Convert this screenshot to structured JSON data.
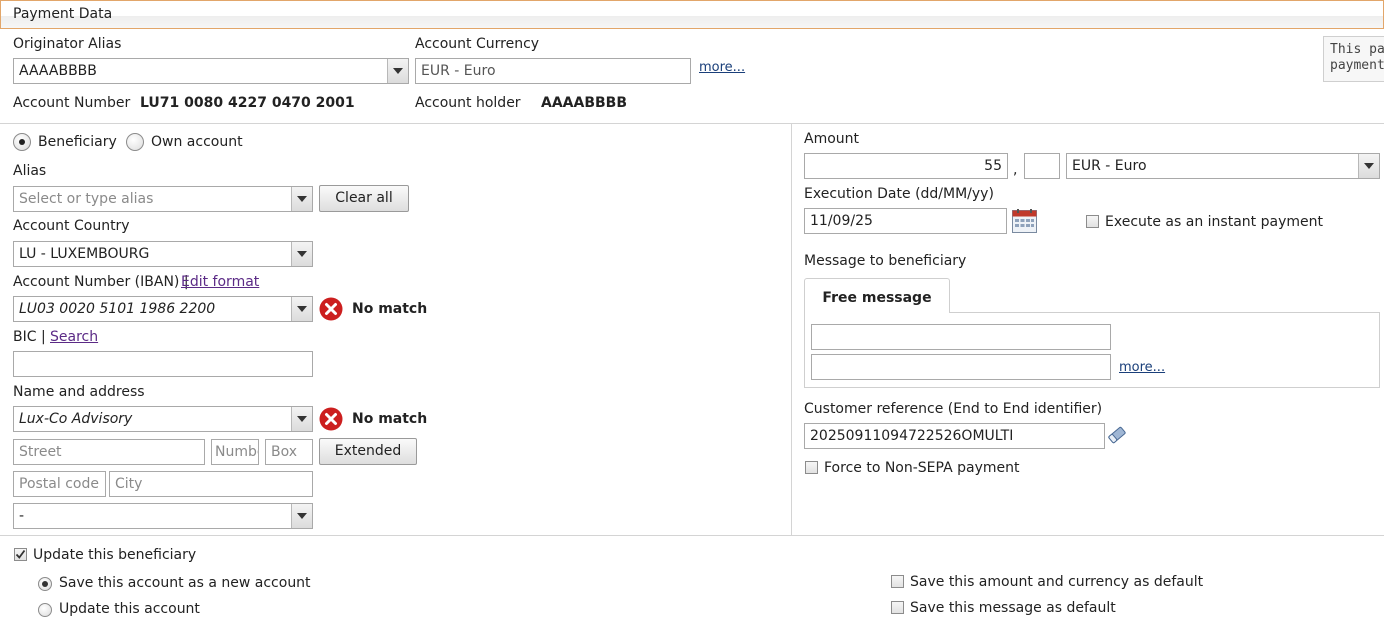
{
  "header": {
    "title": "Payment Data"
  },
  "originator": {
    "alias_label": "Originator Alias",
    "alias_value": "AAAABBBB",
    "currency_label": "Account Currency",
    "currency_value": "EUR - Euro",
    "more": "more...",
    "account_number_label": "Account Number",
    "account_number_value": "LU71 0080 4227 0470 2001",
    "account_holder_label": "Account holder",
    "account_holder_value": "AAAABBBB"
  },
  "side_note": {
    "line1": "This pay",
    "line2": "payment"
  },
  "recipient": {
    "beneficiary_label": "Beneficiary",
    "own_account_label": "Own account",
    "alias_label": "Alias",
    "alias_placeholder": "Select or type alias",
    "clear_all": "Clear all",
    "country_label": "Account Country",
    "country_value": "LU - LUXEMBOURG",
    "iban_label": "Account Number (IBAN) |",
    "edit_format": "Edit format",
    "iban_value": "LU03 0020 5101 1986 2200",
    "no_match": "No match",
    "bic_label": "BIC |",
    "search": "Search",
    "bic_value": "",
    "name_label": "Name and address",
    "name_value": "Lux-Co Advisory",
    "street_placeholder": "Street",
    "number_placeholder": "Numbe",
    "box_placeholder": "Box",
    "extended": "Extended",
    "postal_placeholder": "Postal code",
    "city_placeholder": "City",
    "region_value": "-"
  },
  "payment": {
    "amount_label": "Amount",
    "amount_value": "55",
    "decimal_sep": ",",
    "cents_value": "",
    "currency_value": "EUR - Euro",
    "exec_date_label": "Execution Date (dd/MM/yy)",
    "exec_date_value": "11/09/25",
    "instant_label": "Execute as an instant payment",
    "message_label": "Message to beneficiary",
    "message_tab": "Free message",
    "message_line1": "",
    "message_line2": "",
    "more": "more...",
    "customer_ref_label": "Customer reference (End to End identifier)",
    "customer_ref_value": "20250911094722526OMULTI",
    "non_sepa_label": "Force to Non-SEPA payment"
  },
  "footer": {
    "update_beneficiary": "Update this beneficiary",
    "save_new_account": "Save this account as a new account",
    "update_account": "Update this account",
    "save_amount_default": "Save this amount and currency as default",
    "save_message_default": "Save this message as default"
  },
  "colors": {
    "header_border": "#e2a66a",
    "link": "#1a3f7a",
    "error_red": "#cc1f1f"
  }
}
